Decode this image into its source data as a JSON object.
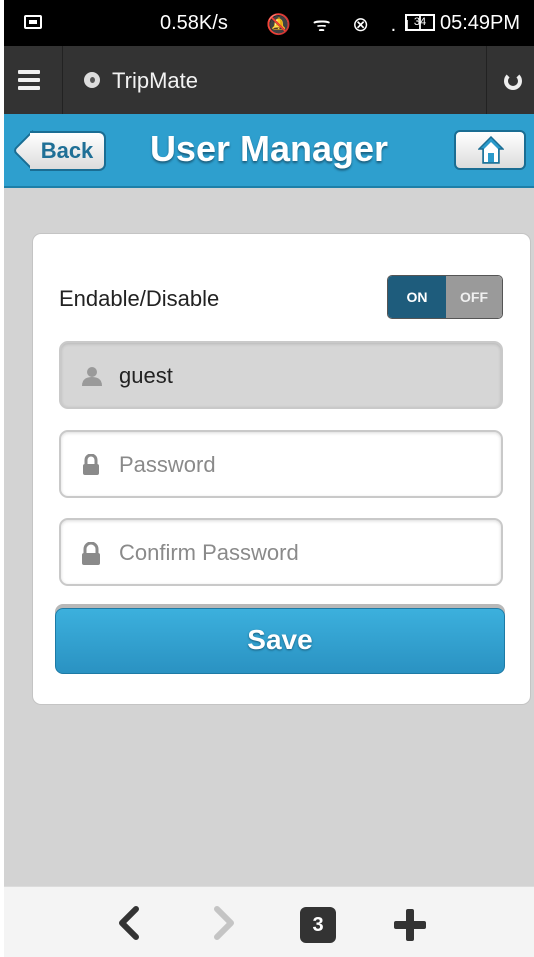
{
  "status_bar": {
    "speed": "0.58K/s",
    "icons": "🔕 ᯤ ⊗ .ıl",
    "battery": "34",
    "time": "05:49PM"
  },
  "browser": {
    "site_title": "TripMate"
  },
  "header": {
    "back_label": "Back",
    "title": "User Manager"
  },
  "form": {
    "enable_label": "Endable/Disable",
    "toggle_on": "ON",
    "toggle_off": "OFF",
    "username_value": "guest",
    "password_placeholder": "Password",
    "confirm_placeholder": "Confirm Password",
    "save_label": "Save"
  },
  "bottom_nav": {
    "tabs_count": "3"
  },
  "colors": {
    "accent": "#2e9fce",
    "toggle_on": "#1e5c7c"
  }
}
